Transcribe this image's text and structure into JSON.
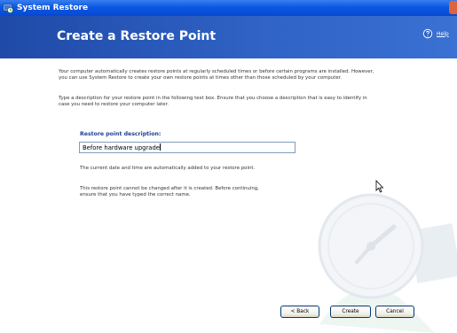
{
  "window": {
    "title": "System Restore"
  },
  "header": {
    "heading": "Create a Restore Point",
    "help_label": "Help"
  },
  "content": {
    "intro": "Your computer automatically creates restore points at regularly scheduled times or before certain programs are installed. However, you can use System Restore to create your own restore points at times other than those scheduled by your computer.",
    "instruction": "Type a description for your restore point in the following text box. Ensure that you choose a description that is easy to identify in case you need to restore your computer later.",
    "description_label": "Restore point description:",
    "description_value": "Before hardware upgrade",
    "date_note": "The current date and time are automatically added to your restore point.",
    "change_note": "This restore point cannot be changed after it is created. Before continuing, ensure that you have typed the correct name."
  },
  "buttons": {
    "back": "< Back",
    "create": "Create",
    "cancel": "Cancel"
  }
}
